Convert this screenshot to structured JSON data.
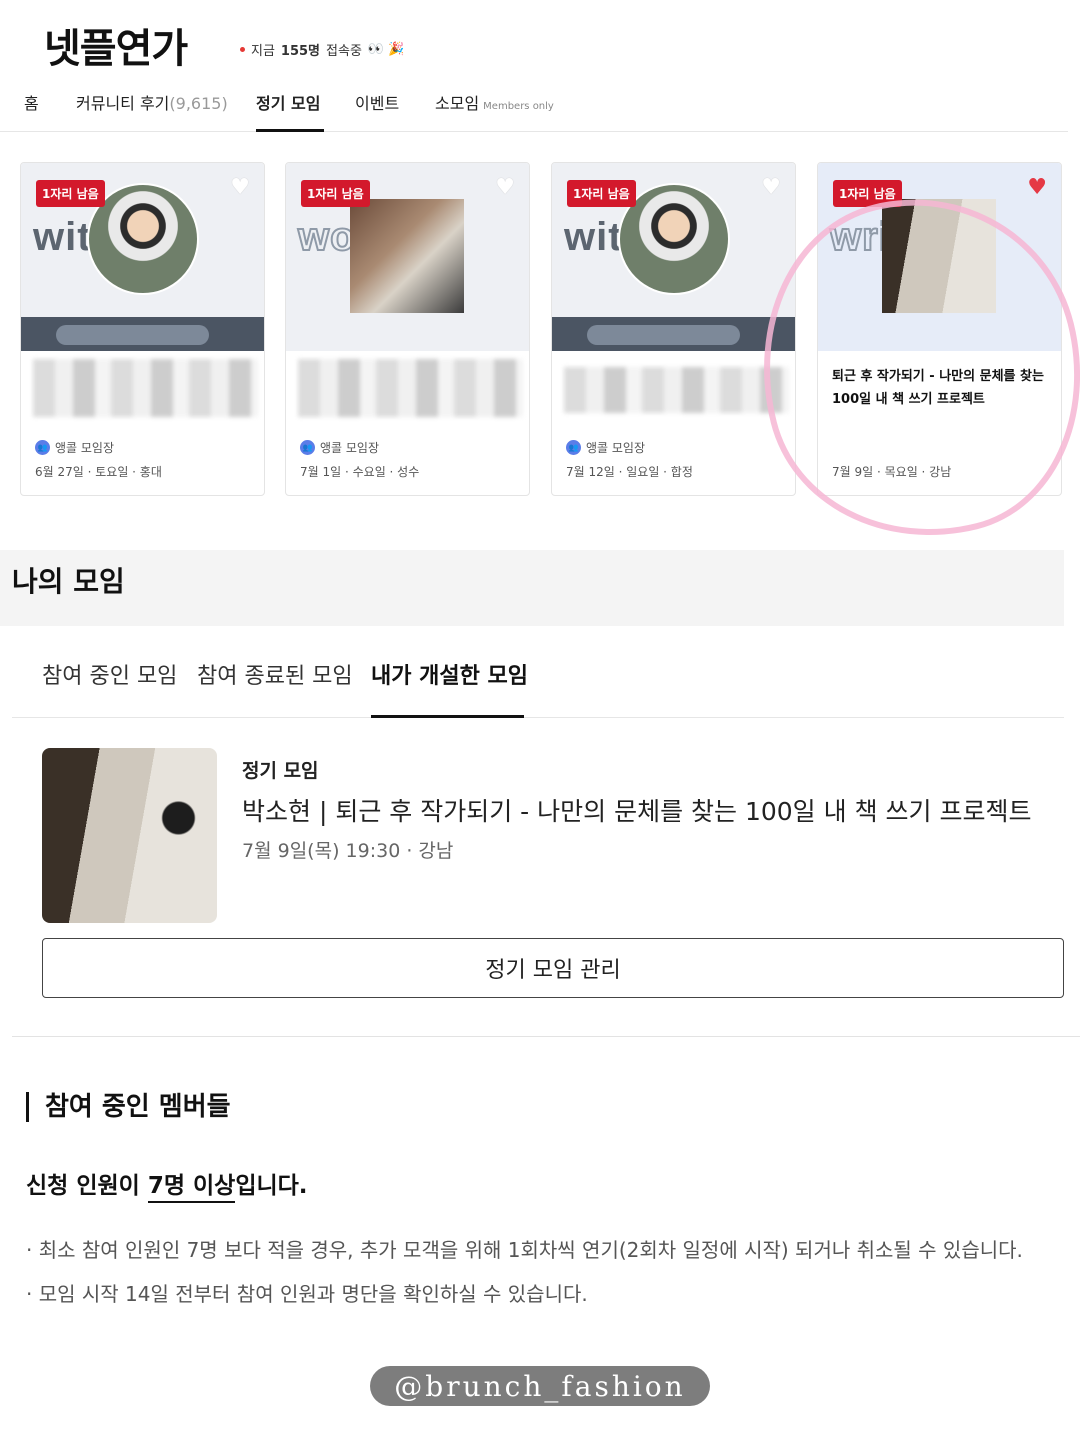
{
  "header": {
    "logo": "넷플연가",
    "online": {
      "prefix": "지금",
      "count": "155명",
      "suffix": "접속중",
      "emoji": "👀 🎉"
    }
  },
  "nav": {
    "items": [
      {
        "label": "홈"
      },
      {
        "label": "커뮤니티 후기",
        "count": "(9,615)"
      },
      {
        "label": "정기 모임"
      },
      {
        "label": "이벤트"
      },
      {
        "label": "소모임",
        "tag": "Members only"
      }
    ]
  },
  "cards": [
    {
      "badge": "1자리 남음",
      "word": "with",
      "title": "",
      "host": "앵콜 모임장",
      "date": "6월 27일 · 토요일 · 홍대",
      "liked": false
    },
    {
      "badge": "1자리 남음",
      "word": "work",
      "title": "",
      "host": "앵콜 모임장",
      "date": "7월 1일 · 수요일 · 성수",
      "liked": false
    },
    {
      "badge": "1자리 남음",
      "word": "with",
      "title": "",
      "host": "앵콜 모임장",
      "date": "7월 12일 · 일요일 · 합정",
      "liked": false
    },
    {
      "badge": "1자리 남음",
      "word": "write",
      "title": "퇴근 후 작가되기 - 나만의 문체를 찾는 100일 내 책 쓰기 프로젝트",
      "host": "",
      "date": "7월 9일 · 목요일 · 강남",
      "liked": true
    }
  ],
  "my": {
    "title": "나의 모임",
    "tabs": [
      "참여 중인 모임",
      "참여 종료된 모임",
      "내가 개설한 모임"
    ],
    "meeting": {
      "type": "정기 모임",
      "title": "박소현 | 퇴근 후 작가되기 - 나만의 문체를 찾는 100일 내 책 쓰기 프로젝트",
      "date": "7월 9일(목) 19:30 · 강남"
    },
    "manage_button": "정기 모임 관리"
  },
  "members": {
    "title": "참여 중인 멤버들",
    "subtitle_a": "신청 인원이 ",
    "subtitle_b": "7명 이상",
    "subtitle_c": "입니다.",
    "notes": [
      "· 최소 참여 인원인 7명 보다 적을 경우, 추가 모객을 위해 1회차씩 연기(2회차 일정에 시작) 되거나 취소될 수 있습니다.",
      "· 모임 시작 14일 전부터 참여 인원과 명단을 확인하실 수 있습니다."
    ]
  },
  "watermark": "@brunch_fashion",
  "colors": {
    "badge": "#d3192c",
    "heart_liked": "#e53945",
    "annotation_ring": "#f6b6d3"
  }
}
